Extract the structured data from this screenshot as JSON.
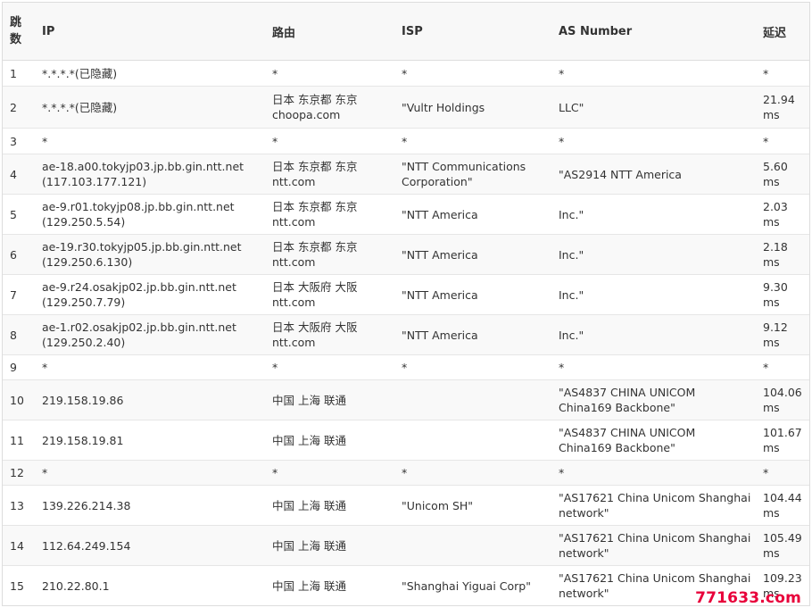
{
  "headers": {
    "hop": [
      "跳",
      "数"
    ],
    "ip": "IP",
    "route": "路由",
    "isp": "ISP",
    "as": "AS Number",
    "latency": "延迟"
  },
  "rows": [
    {
      "hop": "1",
      "ip": [
        "*.*.*.*(已隐藏)"
      ],
      "route": [
        "*"
      ],
      "isp": [
        "*"
      ],
      "as": [
        "*"
      ],
      "latency": [
        "*"
      ]
    },
    {
      "hop": "2",
      "ip": [
        "*.*.*.*(已隐藏)"
      ],
      "route": [
        "日本 东京都 东京",
        "choopa.com"
      ],
      "isp": [
        "\"Vultr Holdings"
      ],
      "as": [
        "LLC\""
      ],
      "latency": [
        "21.94",
        "ms"
      ]
    },
    {
      "hop": "3",
      "ip": [
        "*"
      ],
      "route": [
        "*"
      ],
      "isp": [
        "*"
      ],
      "as": [
        "*"
      ],
      "latency": [
        "*"
      ]
    },
    {
      "hop": "4",
      "ip": [
        "ae-18.a00.tokyjp03.jp.bb.gin.ntt.net",
        "(117.103.177.121)"
      ],
      "route": [
        "日本 东京都 东京",
        "ntt.com"
      ],
      "isp": [
        "\"NTT Communications",
        "Corporation\""
      ],
      "as": [
        "\"AS2914 NTT America"
      ],
      "latency": [
        "5.60",
        "ms"
      ]
    },
    {
      "hop": "5",
      "ip": [
        "ae-9.r01.tokyjp08.jp.bb.gin.ntt.net",
        "(129.250.5.54)"
      ],
      "route": [
        "日本 东京都 东京",
        "ntt.com"
      ],
      "isp": [
        "\"NTT America"
      ],
      "as": [
        "Inc.\""
      ],
      "latency": [
        "2.03",
        "ms"
      ]
    },
    {
      "hop": "6",
      "ip": [
        "ae-19.r30.tokyjp05.jp.bb.gin.ntt.net",
        "(129.250.6.130)"
      ],
      "route": [
        "日本 东京都 东京",
        "ntt.com"
      ],
      "isp": [
        "\"NTT America"
      ],
      "as": [
        "Inc.\""
      ],
      "latency": [
        "2.18",
        "ms"
      ]
    },
    {
      "hop": "7",
      "ip": [
        "ae-9.r24.osakjp02.jp.bb.gin.ntt.net",
        "(129.250.7.79)"
      ],
      "route": [
        "日本 大阪府 大阪",
        "ntt.com"
      ],
      "isp": [
        "\"NTT America"
      ],
      "as": [
        "Inc.\""
      ],
      "latency": [
        "9.30",
        "ms"
      ]
    },
    {
      "hop": "8",
      "ip": [
        "ae-1.r02.osakjp02.jp.bb.gin.ntt.net",
        "(129.250.2.40)"
      ],
      "route": [
        "日本 大阪府 大阪",
        "ntt.com"
      ],
      "isp": [
        "\"NTT America"
      ],
      "as": [
        "Inc.\""
      ],
      "latency": [
        "9.12",
        "ms"
      ]
    },
    {
      "hop": "9",
      "ip": [
        "*"
      ],
      "route": [
        "*"
      ],
      "isp": [
        "*"
      ],
      "as": [
        "*"
      ],
      "latency": [
        "*"
      ]
    },
    {
      "hop": "10",
      "ip": [
        "219.158.19.86"
      ],
      "route": [
        "中国 上海 联通"
      ],
      "isp": [
        ""
      ],
      "as": [
        "\"AS4837 CHINA UNICOM",
        "China169 Backbone\""
      ],
      "latency": [
        "104.06",
        "ms"
      ]
    },
    {
      "hop": "11",
      "ip": [
        "219.158.19.81"
      ],
      "route": [
        "中国 上海 联通"
      ],
      "isp": [
        ""
      ],
      "as": [
        "\"AS4837 CHINA UNICOM",
        "China169 Backbone\""
      ],
      "latency": [
        "101.67",
        "ms"
      ]
    },
    {
      "hop": "12",
      "ip": [
        "*"
      ],
      "route": [
        "*"
      ],
      "isp": [
        "*"
      ],
      "as": [
        "*"
      ],
      "latency": [
        "*"
      ]
    },
    {
      "hop": "13",
      "ip": [
        "139.226.214.38"
      ],
      "route": [
        "中国 上海 联通"
      ],
      "isp": [
        "\"Unicom SH\""
      ],
      "as": [
        "\"AS17621 China Unicom Shanghai",
        "network\""
      ],
      "latency": [
        "104.44",
        "ms"
      ]
    },
    {
      "hop": "14",
      "ip": [
        "112.64.249.154"
      ],
      "route": [
        "中国 上海 联通"
      ],
      "isp": [
        ""
      ],
      "as": [
        "\"AS17621 China Unicom Shanghai",
        "network\""
      ],
      "latency": [
        "105.49",
        "ms"
      ]
    },
    {
      "hop": "15",
      "ip": [
        "210.22.80.1"
      ],
      "route": [
        "中国 上海 联通"
      ],
      "isp": [
        "\"Shanghai Yiguai Corp\""
      ],
      "as": [
        "\"AS17621 China Unicom Shanghai",
        "network\""
      ],
      "latency": [
        "109.23",
        "ms"
      ]
    }
  ],
  "watermark": "771633.com"
}
